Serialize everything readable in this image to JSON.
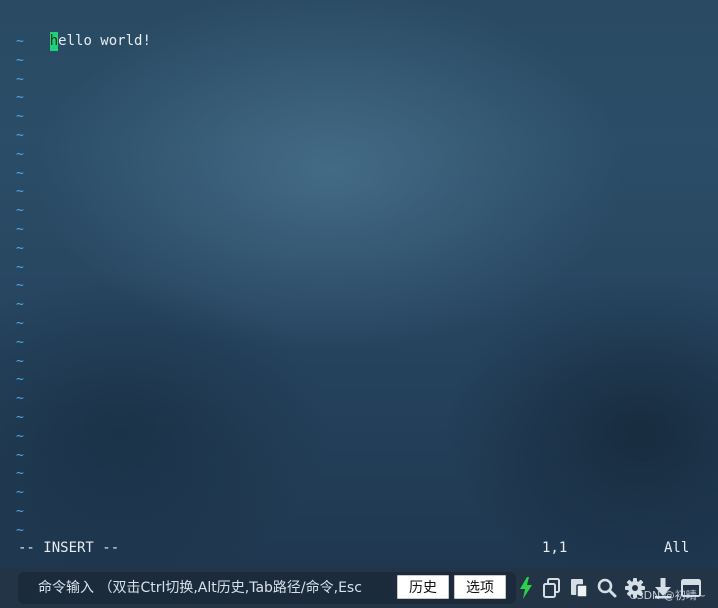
{
  "editor": {
    "cursor_char": "h",
    "first_line_rest": "ello world!",
    "empty_line_marker": "~",
    "empty_line_count": 27,
    "mode_indicator": "-- INSERT --",
    "cursor_position": "1,1",
    "scroll_position": "All"
  },
  "command_bar": {
    "placeholder": "命令输入 （双击Ctrl切换,Alt历史,Tab路径/命令,Esc",
    "history_button": "历史",
    "options_button": "选项"
  },
  "icons": [
    "lightning-icon",
    "copy-icon",
    "paste-icon",
    "search-icon",
    "gear-icon",
    "download-icon",
    "window-icon"
  ],
  "watermark": "CSDN @初晴~",
  "colors": {
    "cursor": "#1fd17a",
    "tilde": "#4fa9e6",
    "lightning": "#2bd14a"
  }
}
